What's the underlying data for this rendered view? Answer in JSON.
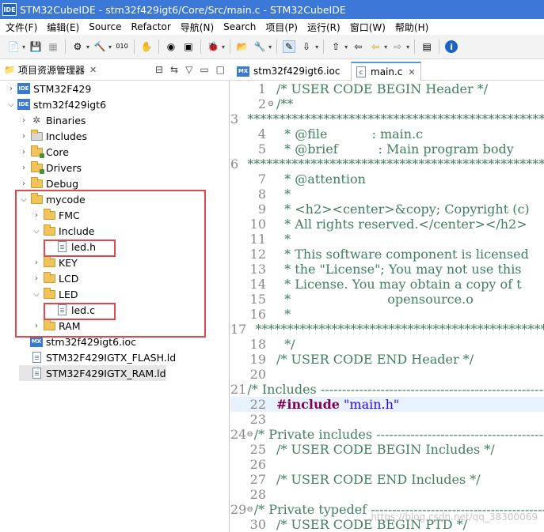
{
  "window": {
    "title": "STM32CubeIDE - stm32f429igt6/Core/Src/main.c - STM32CubeIDE",
    "logo": "IDE"
  },
  "menu": [
    "文件(F)",
    "编辑(E)",
    "Source",
    "Refactor",
    "导航(N)",
    "Search",
    "项目(P)",
    "运行(R)",
    "窗口(W)",
    "帮助(H)"
  ],
  "explorer": {
    "title": "项目资源管理器",
    "close": "✕",
    "items": [
      {
        "label": "STM32F429",
        "arrow": "›",
        "icon": "ide-project-icon"
      },
      {
        "label": "stm32f429igt6",
        "arrow": "⌄",
        "icon": "ide-project-icon"
      },
      {
        "label": "Binaries",
        "arrow": "›",
        "icon": "binaries-icon"
      },
      {
        "label": "Includes",
        "arrow": "›",
        "icon": "includes-icon"
      },
      {
        "label": "Core",
        "arrow": "›",
        "icon": "source-folder-icon"
      },
      {
        "label": "Drivers",
        "arrow": "›",
        "icon": "source-folder-icon"
      },
      {
        "label": "Debug",
        "arrow": "›",
        "icon": "folder-icon"
      },
      {
        "label": "mycode",
        "arrow": "⌄",
        "icon": "folder-icon"
      },
      {
        "label": "FMC",
        "arrow": "›",
        "icon": "folder-icon"
      },
      {
        "label": "Include",
        "arrow": "⌄",
        "icon": "folder-icon"
      },
      {
        "label": "led.h",
        "arrow": "",
        "icon": "header-file-icon"
      },
      {
        "label": "KEY",
        "arrow": "›",
        "icon": "folder-icon"
      },
      {
        "label": "LCD",
        "arrow": "›",
        "icon": "folder-icon"
      },
      {
        "label": "LED",
        "arrow": "⌄",
        "icon": "folder-icon"
      },
      {
        "label": "led.c",
        "arrow": "",
        "icon": "c-file-icon"
      },
      {
        "label": "RAM",
        "arrow": "›",
        "icon": "folder-icon"
      },
      {
        "label": "stm32f429igt6.ioc",
        "arrow": "",
        "icon": "ioc-file-icon"
      },
      {
        "label": "STM32F429IGTX_FLASH.ld",
        "arrow": "",
        "icon": "ld-file-icon"
      },
      {
        "label": "STM32F429IGTX_RAM.ld",
        "arrow": "",
        "icon": "ld-file-icon"
      }
    ]
  },
  "editor": {
    "tabs": [
      {
        "label": "stm32f429igt6.ioc",
        "icon": "MX"
      },
      {
        "label": "main.c",
        "icon": "c",
        "close": "✕"
      }
    ],
    "lines": [
      {
        "n": "1",
        "fold": "",
        "text": "/* USER CODE BEGIN Header */",
        "cls": "cm"
      },
      {
        "n": "2",
        "fold": "⊖",
        "text": "/**",
        "cls": "cm"
      },
      {
        "n": "3",
        "fold": "",
        "text": "  ******************************************************************************",
        "cls": "cm"
      },
      {
        "n": "4",
        "fold": "",
        "text": "  * @file           : main.c",
        "cls": "cm"
      },
      {
        "n": "5",
        "fold": "",
        "text": "  * @brief          : Main program body",
        "cls": "cm"
      },
      {
        "n": "6",
        "fold": "",
        "text": "  ******************************************************************************",
        "cls": "cm"
      },
      {
        "n": "7",
        "fold": "",
        "text": "  * @attention",
        "cls": "cm"
      },
      {
        "n": "8",
        "fold": "",
        "text": "  *",
        "cls": "cm"
      },
      {
        "n": "9",
        "fold": "",
        "text": "  * <h2><center>&copy; Copyright (c)",
        "cls": "cm"
      },
      {
        "n": "10",
        "fold": "",
        "text": "  * All rights reserved.</center></h2>",
        "cls": "cm"
      },
      {
        "n": "11",
        "fold": "",
        "text": "  *",
        "cls": "cm"
      },
      {
        "n": "12",
        "fold": "",
        "text": "  * This software component is licensed",
        "cls": "cm"
      },
      {
        "n": "13",
        "fold": "",
        "text": "  * the \"License\"; You may not use this",
        "cls": "cm"
      },
      {
        "n": "14",
        "fold": "",
        "text": "  * License. You may obtain a copy of t",
        "cls": "cm"
      },
      {
        "n": "15",
        "fold": "",
        "text": "  *                        opensource.o",
        "cls": "cm"
      },
      {
        "n": "16",
        "fold": "",
        "text": "  *",
        "cls": "cm"
      },
      {
        "n": "17",
        "fold": "",
        "text": "  ******************************************************************************",
        "cls": "cm"
      },
      {
        "n": "18",
        "fold": "",
        "text": "  */",
        "cls": "cm"
      },
      {
        "n": "19",
        "fold": "",
        "text": "/* USER CODE END Header */",
        "cls": "cm"
      },
      {
        "n": "20",
        "fold": "",
        "text": "",
        "cls": ""
      },
      {
        "n": "21",
        "fold": "",
        "text": "/* Includes ------------------------------------------------------------------",
        "cls": "cm"
      },
      {
        "n": "22",
        "fold": "",
        "text": "",
        "cls": "",
        "include": true
      },
      {
        "n": "23",
        "fold": "",
        "text": "",
        "cls": ""
      },
      {
        "n": "24",
        "fold": "⊖",
        "text": "/* Private includes ----------------------------------------------------------",
        "cls": "cm"
      },
      {
        "n": "25",
        "fold": "",
        "text": "/* USER CODE BEGIN Includes */",
        "cls": "cm"
      },
      {
        "n": "26",
        "fold": "",
        "text": "",
        "cls": ""
      },
      {
        "n": "27",
        "fold": "",
        "text": "/* USER CODE END Includes */",
        "cls": "cm"
      },
      {
        "n": "28",
        "fold": "",
        "text": "",
        "cls": ""
      },
      {
        "n": "29",
        "fold": "⊖",
        "text": "/* Private typedef -----------------------------------------------------------",
        "cls": "cm"
      },
      {
        "n": "30",
        "fold": "",
        "text": "/* USER CODE BEGIN PTD */",
        "cls": "cm"
      }
    ],
    "include_keyword": "#include",
    "include_file": "\"main.h\"",
    "watermark": "https://blog.csdn.net/qq_38300069"
  }
}
